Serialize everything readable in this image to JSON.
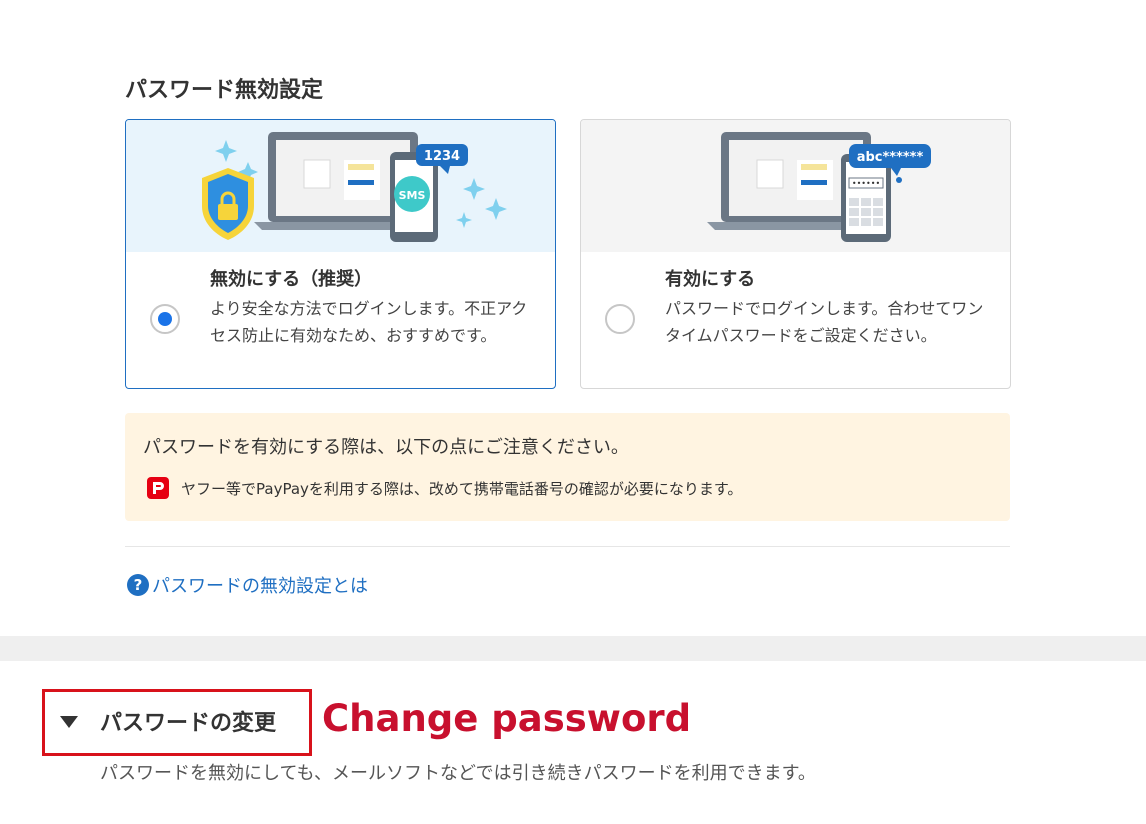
{
  "page_title": "パスワード無効設定",
  "options": [
    {
      "title": "無効にする（推奨）",
      "description": "より安全な方法でログインします。不正アクセス防止に有効なため、おすすめです。",
      "selected": true,
      "bubble_text": "1234",
      "chip_text": "SMS"
    },
    {
      "title": "有効にする",
      "description": "パスワードでログインします。合わせてワンタイムパスワードをご設定ください。",
      "selected": false,
      "bubble_text": "abc******",
      "field_text": "••••••"
    }
  ],
  "notice": {
    "heading": "パスワードを有効にする際は、以下の点にご注意ください。",
    "item": "ヤフー等でPayPayを利用する際は、改めて携帯電話番号の確認が必要になります。",
    "icon": "paypay-icon"
  },
  "help_link": {
    "icon_glyph": "?",
    "label": "パスワードの無効設定とは"
  },
  "change_password": {
    "label": "パスワードの変更",
    "annotation": "Change password",
    "description": "パスワードを無効にしても、メールソフトなどでは引き続きパスワードを利用できます。"
  },
  "colors": {
    "accent": "#1f6fc2",
    "radio_selected": "#1a73e8",
    "notice_bg": "#fff4e1",
    "annotation_red": "#c8102e",
    "highlight_box": "#d8121b"
  }
}
